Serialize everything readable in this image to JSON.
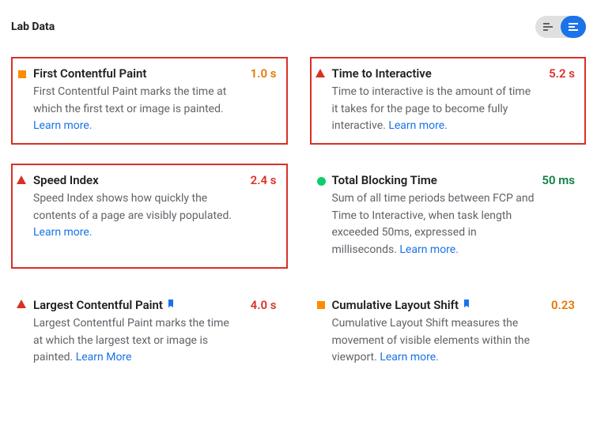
{
  "header": {
    "title": "Lab Data"
  },
  "colors": {
    "warn": "#e67700",
    "bad": "#d93025",
    "good": "#0b8043",
    "link": "#1a73e8"
  },
  "metrics": [
    {
      "id": "fcp",
      "status": "warn",
      "highlighted": true,
      "flag": false,
      "title": "First Contentful Paint",
      "value": "1.0 s",
      "desc": "First Contentful Paint marks the time at which the first text or image is painted.",
      "learn": "Learn more."
    },
    {
      "id": "tti",
      "status": "bad",
      "highlighted": true,
      "flag": false,
      "title": "Time to Interactive",
      "value": "5.2 s",
      "desc": "Time to interactive is the amount of time it takes for the page to become fully interactive.",
      "learn": "Learn more."
    },
    {
      "id": "si",
      "status": "bad",
      "highlighted": true,
      "flag": false,
      "title": "Speed Index",
      "value": "2.4 s",
      "desc": "Speed Index shows how quickly the contents of a page are visibly populated.",
      "learn": "Learn more."
    },
    {
      "id": "tbt",
      "status": "good",
      "highlighted": false,
      "flag": false,
      "title": "Total Blocking Time",
      "value": "50 ms",
      "desc": "Sum of all time periods between FCP and Time to Interactive, when task length exceeded 50ms, expressed in milliseconds.",
      "learn": "Learn more."
    },
    {
      "id": "lcp",
      "status": "bad",
      "highlighted": false,
      "flag": true,
      "title": "Largest Contentful Paint",
      "value": "4.0 s",
      "desc": "Largest Contentful Paint marks the time at which the largest text or image is painted.",
      "learn": "Learn More"
    },
    {
      "id": "cls",
      "status": "warn",
      "highlighted": false,
      "flag": true,
      "title": "Cumulative Layout Shift",
      "value": "0.23",
      "desc": "Cumulative Layout Shift measures the movement of visible elements within the viewport.",
      "learn": "Learn more."
    }
  ]
}
